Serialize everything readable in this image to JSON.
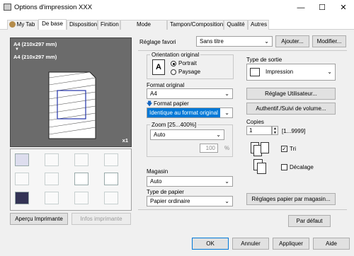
{
  "window": {
    "title": "Options d'impression XXX",
    "controls": {
      "minimize": "—",
      "maximize": "☐",
      "close": "✕"
    }
  },
  "tabs": [
    "My Tab",
    "De base",
    "Disposition",
    "Finition",
    "Mode Couverture",
    "Tampon/Composition",
    "Qualité",
    "Autres"
  ],
  "preview": {
    "paper_top": "A4 (210x297 mm)",
    "arrow": "▼",
    "paper_bottom": "A4 (210x297 mm)",
    "copies_badge": "x1"
  },
  "left_buttons": {
    "printer_view": "Aperçu Imprimante",
    "printer_info": "Infos imprimante"
  },
  "favorite": {
    "label": "Réglage favori",
    "value": "Sans titre",
    "add": "Ajouter...",
    "edit": "Modifier..."
  },
  "orientation": {
    "label": "Orientation original",
    "portrait": "Portrait",
    "landscape": "Paysage",
    "icon": "A"
  },
  "original_format": {
    "label": "Format original",
    "value": "A4"
  },
  "paper_format": {
    "label": "Format papier",
    "value": "Identique au format original"
  },
  "zoom": {
    "label": "Zoom [25...400%]",
    "value": "Auto",
    "percent": "100",
    "unit": "%"
  },
  "tray": {
    "label": "Magasin",
    "value": "Auto"
  },
  "paper_type": {
    "label": "Type de papier",
    "value": "Papier ordinaire"
  },
  "output": {
    "label": "Type de sortie",
    "value": "Impression"
  },
  "buttons": {
    "user_settings": "Réglage Utilisateur...",
    "auth": "Authentif./Suivi de volume...",
    "tray_settings": "Réglages papier par magasin...",
    "default": "Par défaut",
    "ok": "OK",
    "cancel": "Annuler",
    "apply": "Appliquer",
    "help": "Aide"
  },
  "copies": {
    "label": "Copies",
    "value": "1",
    "range": "[1...9999]",
    "collate": "Tri",
    "offset": "Décalage"
  }
}
